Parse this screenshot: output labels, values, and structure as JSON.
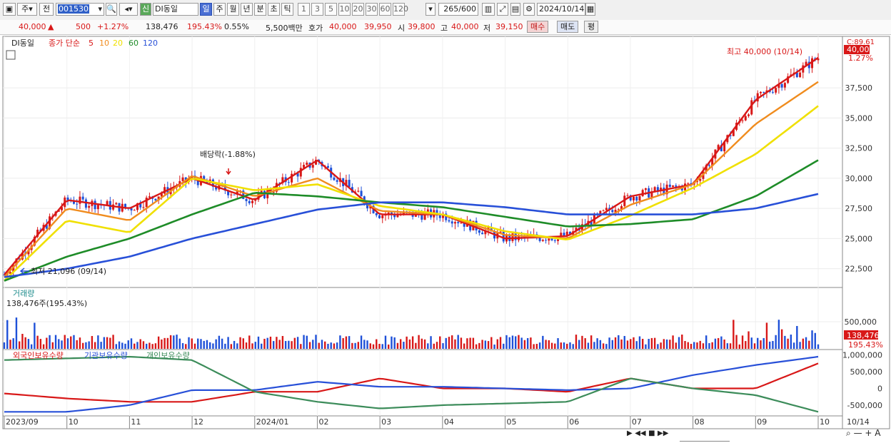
{
  "toolbar": {
    "market_tab": "주",
    "prev_label": "전",
    "code": "001530",
    "credit_badge": "신",
    "stock_name": "DI동일",
    "periods": [
      "일",
      "주",
      "월",
      "년",
      "분",
      "초",
      "틱"
    ],
    "active_period": "일",
    "ranges": [
      "1",
      "3",
      "5",
      "10",
      "20",
      "30",
      "60",
      "120"
    ],
    "count": "265",
    "count_total": "/600",
    "date": "2024/10/14"
  },
  "quote": {
    "price": "40,000",
    "change": "500",
    "change_pct": "+1.27%",
    "volume": "138,476",
    "volume_ratio": "195.43%",
    "turnover_pct": "0.55%",
    "amount": "5,500백만",
    "bid_label": "호가",
    "bid": "40,000",
    "ask": "39,950",
    "open_label": "시",
    "open": "39,800",
    "high_label": "고",
    "high": "40,000",
    "low_label": "저",
    "low": "39,150",
    "buy_label": "매수",
    "sell_label": "매도",
    "eval_label": "평"
  },
  "price_panel": {
    "stock_name": "DI동일",
    "legend_prefix": "종가 단순",
    "ma_periods": [
      "5",
      "10",
      "20",
      "60",
      "120"
    ],
    "high_label": "최고 40,000 (10/14)",
    "low_label": "최저 21,096 (09/14)",
    "dividend_label": "배당락(-1.88%)",
    "scale_top": "C:89.61",
    "current_tag": "40,000",
    "current_pct": "1.27%"
  },
  "volume_panel": {
    "title": "거래량",
    "value_label": "138,476주(195.43%)",
    "current_tag": "138,476",
    "current_pct": "195.43%",
    "tick": "500,000"
  },
  "holdings_panel": {
    "legend": [
      "외국인보유수량",
      "기관보유수량",
      "개인보유수량"
    ],
    "ticks": [
      "1,000,000",
      "500,000",
      "0",
      "-500,000"
    ]
  },
  "x_axis": {
    "labels": [
      "2023/09",
      "10",
      "11",
      "12",
      "2024/01",
      "02",
      "03",
      "04",
      "05",
      "06",
      "07",
      "08",
      "09",
      "10"
    ],
    "last_date": "10/14"
  },
  "colors": {
    "ma5": "#d81818",
    "ma10": "#f08c1e",
    "ma20": "#f0e000",
    "ma60": "#1e8c28",
    "ma120": "#2850d8",
    "up": "#d81818",
    "down": "#1e50d8",
    "foreign": "#d81818",
    "institution": "#2850d8",
    "individual": "#3c8c5a"
  },
  "chart_data": {
    "type": "line",
    "x": [
      "2023/09",
      "2023/10",
      "2023/11",
      "2023/12",
      "2024/01",
      "2024/02",
      "2024/03",
      "2024/04",
      "2024/05",
      "2024/06",
      "2024/07",
      "2024/08",
      "2024/09",
      "2024/10"
    ],
    "series": [
      {
        "name": "5",
        "values": [
          22000,
          28200,
          27500,
          30000,
          28200,
          31500,
          27000,
          27000,
          25000,
          25200,
          28500,
          29500,
          36500,
          40000
        ]
      },
      {
        "name": "10",
        "values": [
          21800,
          27500,
          26500,
          30200,
          28500,
          30000,
          27300,
          27000,
          25300,
          25000,
          27800,
          29500,
          34500,
          38000
        ]
      },
      {
        "name": "20",
        "values": [
          21500,
          26500,
          25500,
          30000,
          29000,
          29500,
          27700,
          27000,
          25600,
          24900,
          26900,
          29200,
          32000,
          36000
        ]
      },
      {
        "name": "60",
        "values": [
          21500,
          23500,
          25000,
          27000,
          28800,
          28500,
          28000,
          27600,
          26800,
          26000,
          26200,
          26600,
          28500,
          31500
        ]
      },
      {
        "name": "120",
        "values": [
          21800,
          22500,
          23500,
          25000,
          26200,
          27400,
          28000,
          28000,
          27600,
          27000,
          27000,
          27000,
          27500,
          28700
        ]
      }
    ],
    "high": {
      "date": "10/14",
      "value": 40000
    },
    "low": {
      "date": "09/14",
      "value": 21096
    },
    "ylim": [
      21000,
      41000
    ],
    "yticks": [
      22500,
      25000,
      27500,
      30000,
      32500,
      35000,
      37500
    ],
    "ytick_labels": [
      "22,500",
      "25,000",
      "27,500",
      "30,000",
      "32,500",
      "35,000",
      "37,500"
    ],
    "volume": {
      "last": 138476,
      "ratio_pct": 195.43
    },
    "holdings": {
      "foreign": [
        -150000,
        -300000,
        -400000,
        -400000,
        -100000,
        -100000,
        300000,
        0,
        0,
        -100000,
        300000,
        0,
        0,
        750000
      ],
      "institution": [
        -700000,
        -700000,
        -500000,
        -50000,
        -50000,
        200000,
        50000,
        50000,
        0,
        -50000,
        0,
        400000,
        700000,
        950000
      ],
      "individual": [
        850000,
        900000,
        950000,
        850000,
        -100000,
        -400000,
        -600000,
        -500000,
        -450000,
        -400000,
        300000,
        0,
        -200000,
        -700000
      ]
    }
  }
}
